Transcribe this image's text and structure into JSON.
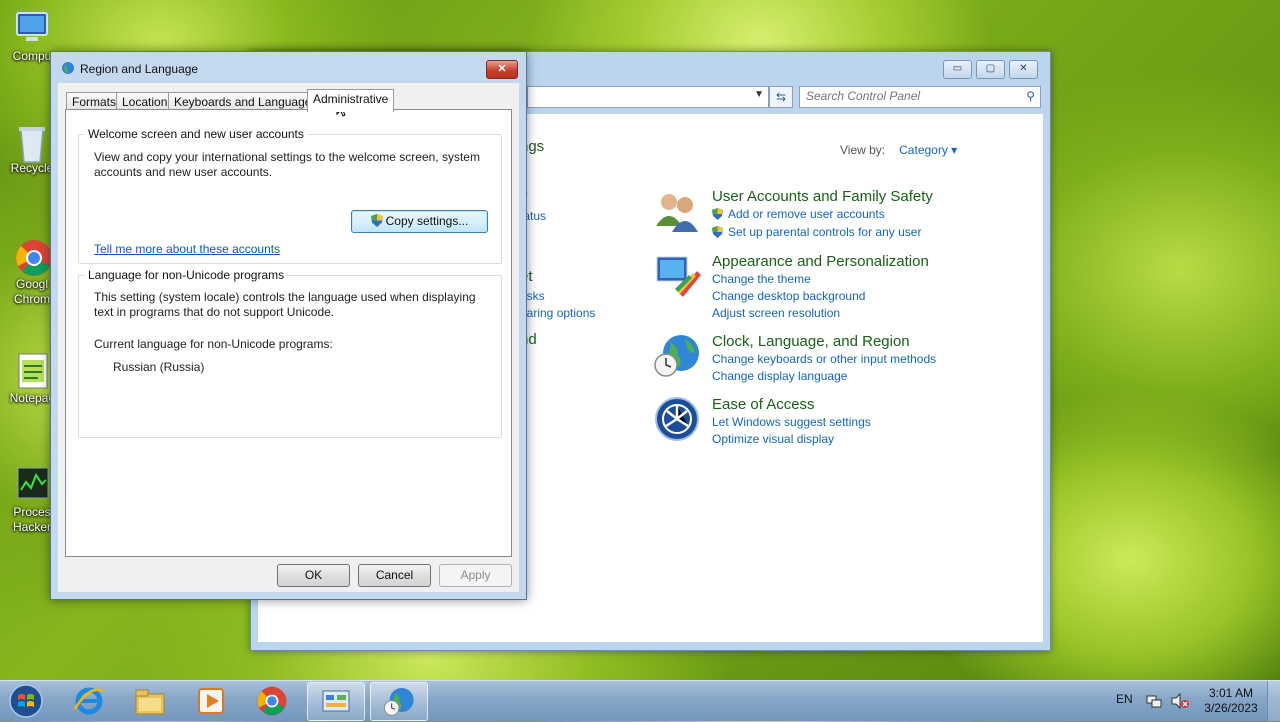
{
  "desktop": {
    "icons": [
      {
        "label": "Compu",
        "icon": "computer-icon"
      },
      {
        "label": "Recycle",
        "icon": "recycle-bin-icon"
      },
      {
        "label": "Googl\nChrom",
        "icon": "chrome-icon"
      },
      {
        "label": "Notepac",
        "icon": "notepad-icon"
      },
      {
        "label": "Proces\nHacker",
        "icon": "process-hacker-icon"
      }
    ]
  },
  "control_panel": {
    "caption_buttons": {
      "minimize": "▭",
      "maximize": "▢",
      "close": "✕"
    },
    "search_placeholder": "Search Control Panel",
    "view_by_label": "View by:",
    "view_by_value": "Category ▾",
    "peek": {
      "title_frag": "ngs",
      "item1": "y",
      "item1_link": "tatus",
      "item2": "et",
      "item2_link1": "asks",
      "item2_link2": "haring options",
      "item3": "nd"
    },
    "categories": [
      {
        "title": "User Accounts and Family Safety",
        "links": [
          "Add or remove user accounts",
          "Set up parental controls for any user"
        ],
        "icon": "users-icon"
      },
      {
        "title": "Appearance and Personalization",
        "links": [
          "Change the theme",
          "Change desktop background",
          "Adjust screen resolution"
        ],
        "icon": "appearance-icon"
      },
      {
        "title": "Clock, Language, and Region",
        "links": [
          "Change keyboards or other input methods",
          "Change display language"
        ],
        "icon": "clock-globe-icon"
      },
      {
        "title": "Ease of Access",
        "links": [
          "Let Windows suggest settings",
          "Optimize visual display"
        ],
        "icon": "ease-of-access-icon"
      }
    ]
  },
  "dialog": {
    "title": "Region and Language",
    "close_label": "✕",
    "tabs": [
      "Formats",
      "Location",
      "Keyboards and Languages",
      "Administrative"
    ],
    "active_tab": "Administrative",
    "welcome_group": {
      "legend": "Welcome screen and new user accounts",
      "text": "View and copy your international settings to the welcome screen, system accounts and new user accounts.",
      "copy_button": "Copy settings...",
      "link": "Tell me more about these accounts"
    },
    "unicode_group": {
      "legend": "Language for non-Unicode programs",
      "text": "This setting (system locale) controls the language used when displaying text in programs that do not support Unicode.",
      "current_label": "Current language for non-Unicode programs:",
      "current_value": "Russian (Russia)"
    },
    "buttons": {
      "ok": "OK",
      "cancel": "Cancel",
      "apply": "Apply"
    }
  },
  "taskbar": {
    "items": [
      "internet-explorer-icon",
      "file-explorer-icon",
      "media-player-icon",
      "chrome-icon",
      "control-panel-icon",
      "region-language-icon"
    ],
    "language": "EN",
    "time": "3:01 AM",
    "date": "3/26/2023"
  }
}
